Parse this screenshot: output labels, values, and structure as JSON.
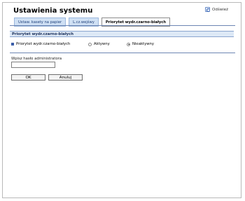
{
  "header": {
    "title": "Ustawienia systemu",
    "refresh_label": "Odśwież",
    "refresh_icon": "refresh-icon"
  },
  "tabs": [
    {
      "label": "Ustaw. kasety na papier",
      "active": false
    },
    {
      "label": "L.cz.wejśwy",
      "active": false
    },
    {
      "label": "Priorytet wydr.czarno-białych",
      "active": true
    }
  ],
  "section": {
    "title": "Priorytet wydr.czarno-białych",
    "row_label": "Priorytet wydr.czarno-białych",
    "options": [
      {
        "label": "Aktywny",
        "selected": false
      },
      {
        "label": "Nieaktywny",
        "selected": true
      }
    ]
  },
  "password": {
    "label": "Wpisz hasło administratora",
    "value": ""
  },
  "buttons": {
    "ok": "OK",
    "cancel": "Anuluj"
  },
  "colors": {
    "accent": "#3b5ea8",
    "section_bg": "#dde8f6",
    "tab_bg": "#cfe0f4"
  }
}
